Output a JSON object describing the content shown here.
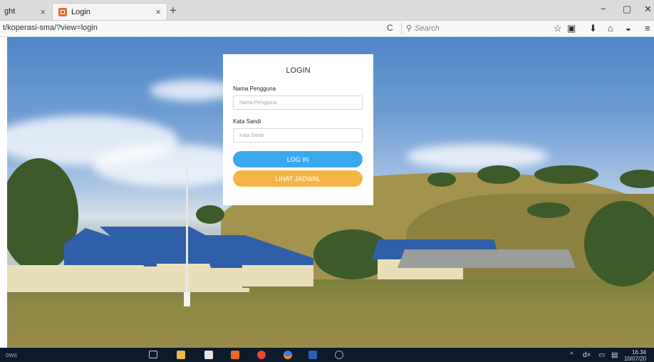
{
  "browser": {
    "tabs": [
      {
        "label": "ght",
        "close": "×"
      },
      {
        "label": "Login",
        "close": "×"
      }
    ],
    "new_tab": "+",
    "window_controls": [
      "−",
      "▢",
      "✕"
    ],
    "url": "t/koperasi-sma/?view=login",
    "reload_glyph": "C",
    "search_glyph": "⚲",
    "search_placeholder": "Search",
    "toolbar_icons": [
      "star-icon",
      "reading-list-icon",
      "download-icon",
      "home-icon",
      "pocket-icon",
      "menu-icon"
    ]
  },
  "login": {
    "title": "LOGIN",
    "username_label": "Nama Pengguna",
    "username_placeholder": "Nama Pengguna",
    "password_label": "Kata Sandi",
    "password_placeholder": "Kata Sandi",
    "login_button": "LOG IN",
    "schedule_button": "LIHAT JADWAL"
  },
  "taskbar": {
    "left_text": "ows",
    "tray_glyphs": [
      "^",
      "d×",
      "▭",
      "▤"
    ],
    "time": "16.34",
    "date": "10/07/20"
  },
  "colors": {
    "login_button": "#3aa8ee",
    "schedule_button": "#f4b545",
    "taskbar": "#0d1a2a"
  }
}
